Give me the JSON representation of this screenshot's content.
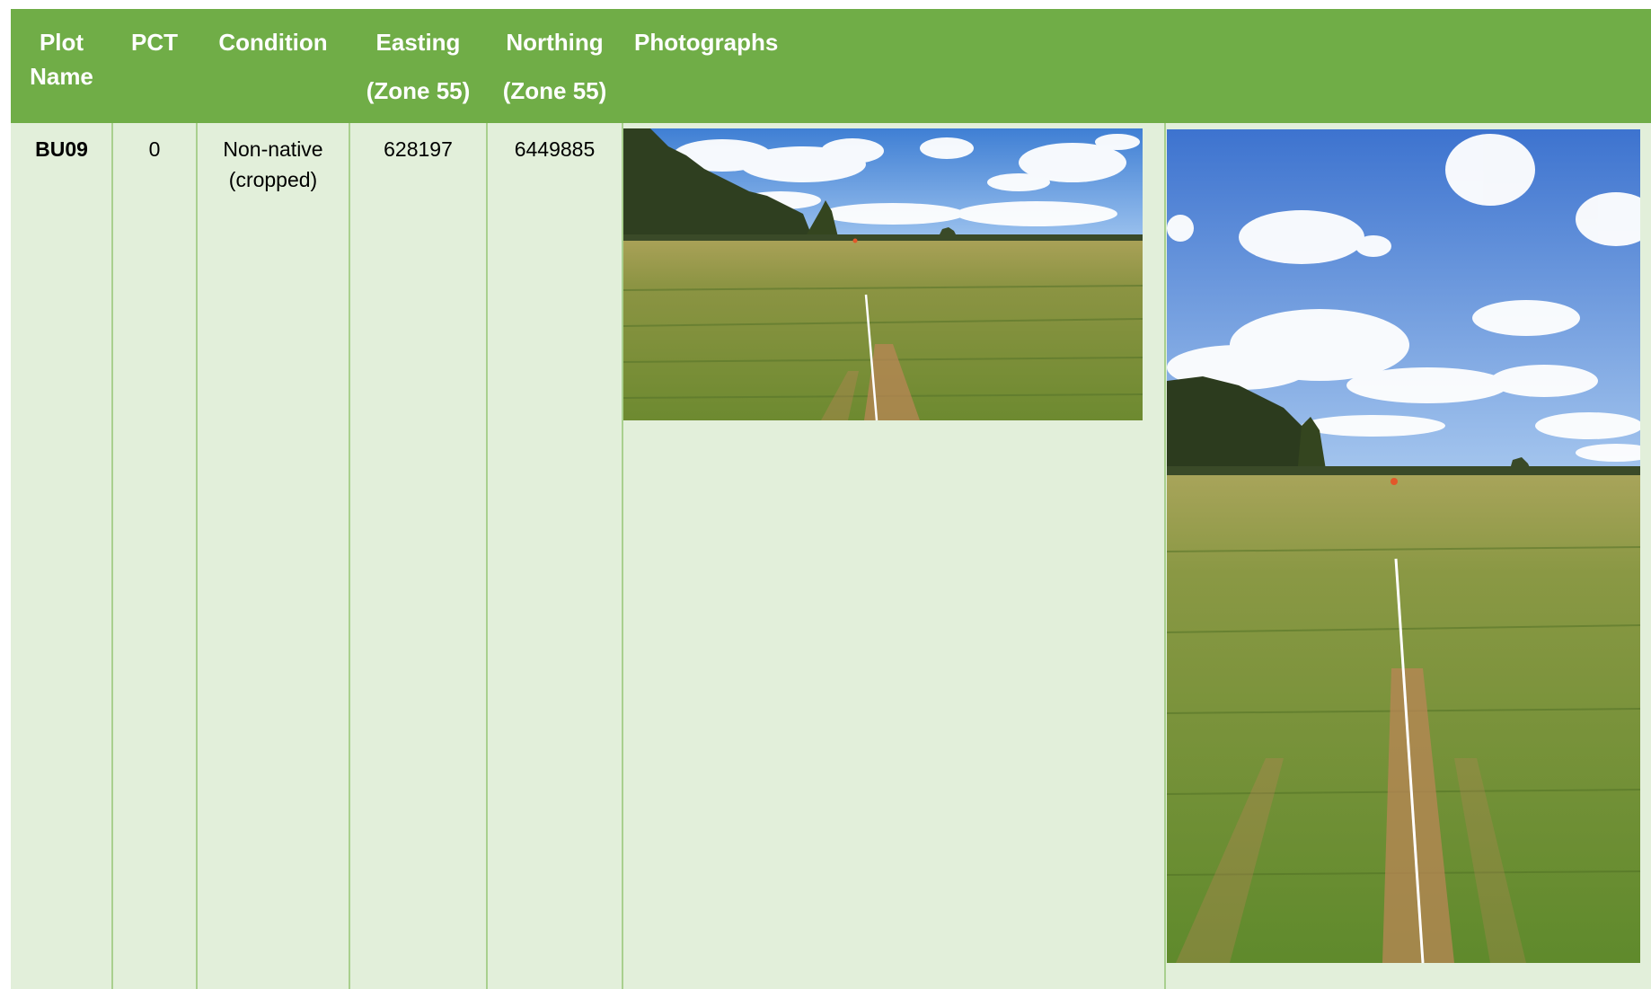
{
  "table": {
    "headers": {
      "plot_name": [
        "Plot",
        "Name"
      ],
      "pct": "PCT",
      "condition": "Condition",
      "easting": [
        "Easting",
        "(Zone 55)"
      ],
      "northing": [
        "Northing",
        "(Zone 55)"
      ],
      "photographs": "Photographs"
    },
    "rows": [
      {
        "plot_name": "BU09",
        "pct": "0",
        "condition": [
          "Non-native",
          "(cropped)"
        ],
        "easting": "628197",
        "northing": "6449885"
      }
    ]
  },
  "colors": {
    "header_bg": "#70ad47",
    "row_bg": "#e2efda",
    "grid_line": "#a9d08e",
    "header_text": "#ffffff"
  }
}
